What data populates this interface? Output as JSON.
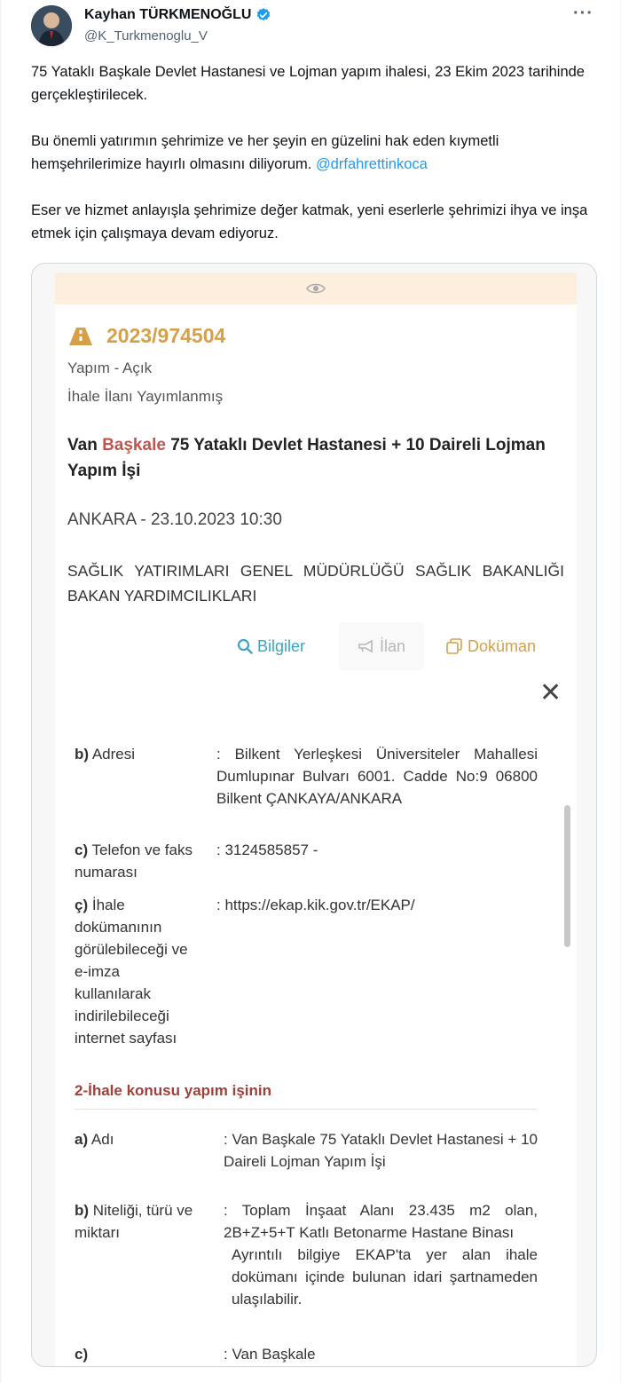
{
  "author": {
    "name": "Kayhan TÜRKMENOĞLU",
    "handle": "@K_Turkmenoglu_V",
    "more_label": "···"
  },
  "tweet": {
    "p1": "75 Yataklı Başkale Devlet Hastanesi ve Lojman yapım ihalesi, 23 Ekim 2023 tarihinde gerçekleştirilecek.",
    "p2_text": "Bu önemli yatırımın şehrimize ve her şeyin en güzelini hak eden kıymetli hemşehrilerimize hayırlı olmasını diliyorum. ",
    "p2_mention": "@drfahrettinkoca",
    "p3": "Eser ve hizmet anlayışla şehrimize değer katmak, yeni eserlerle şehrimizi ihya ve inşa etmek için çalışmaya devam ediyoruz."
  },
  "ihale": {
    "number": "2023/974504",
    "type": "Yapım - Açık",
    "status": "İhale İlanı Yayımlanmış",
    "title_pre": "Van ",
    "title_hl": "Başkale",
    "title_post": " 75 Yataklı Devlet Hastanesi + 10 Daireli Lojman Yapım İşi",
    "date": "ANKARA - 23.10.2023 10:30",
    "org": "SAĞLIK YATIRIMLARI GENEL MÜDÜRLÜĞÜ SAĞLIK BAKANLIĞI BAKAN YARDIMCILIKLARI"
  },
  "actions": {
    "bilgiler": "Bilgiler",
    "ilan": "İlan",
    "dokuman": "Doküman",
    "close": "✕"
  },
  "details": {
    "b_key": "b)",
    "b_label": "Adresi",
    "b_value": ": Bilkent Yerleşkesi Üniversiteler Mahallesi Dumlupınar Bulvarı 6001. Cadde No:9 06800 Bilkent ÇANKAYA/ANKARA",
    "c_key": "c)",
    "c_label": "Telefon ve faks numarası",
    "c_value": ": 3124585857 -",
    "cc_key": "ç)",
    "cc_label": "İhale dokümanının görülebileceği ve e-imza kullanılarak indirilebileceği internet sayfası",
    "cc_value": ": https://ekap.kik.gov.tr/EKAP/",
    "section_title": "2-İhale konusu yapım işinin",
    "a_key": "a)",
    "a_label": "Adı",
    "a_value": ": Van Başkale 75 Yataklı Devlet Hastanesi + 10 Daireli Lojman Yapım İşi",
    "nb_key": "b)",
    "nb_label": "Niteliği, türü ve miktarı",
    "nb_value": ": Toplam İnşaat Alanı 23.435 m2 olan, 2B+Z+5+T Katlı Betonarme Hastane Binası",
    "nb_value2": "Ayrıntılı bilgiye EKAP'ta yer alan ihale dokümanı içinde bulunan idari şartnameden ulaşılabilir.",
    "next_key": "c)",
    "next_value": ": Van Başkale"
  },
  "colors": {
    "accent_gold": "#d6a04a",
    "link_blue": "#1d9bf0",
    "info_teal": "#3aa6c4",
    "section_red": "#a0403a"
  }
}
